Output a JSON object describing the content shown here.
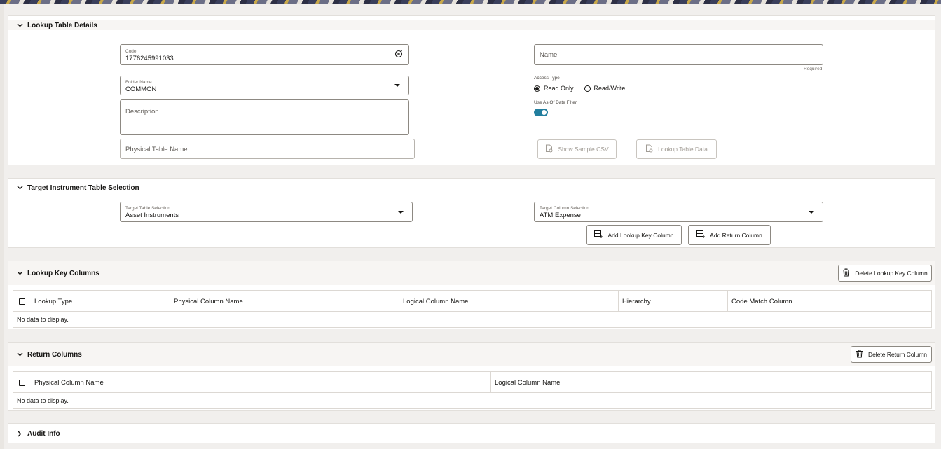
{
  "lookup_table_details": {
    "title": "Lookup Table Details",
    "code": {
      "label": "Code",
      "value": "1776245991033"
    },
    "name": {
      "placeholder": "Name",
      "helper": "Required"
    },
    "folder": {
      "label": "Folder Name",
      "value": "COMMON"
    },
    "access_type": {
      "label": "Access Type",
      "options": [
        {
          "label": "Read Only",
          "selected": true
        },
        {
          "label": "Read/Write",
          "selected": false
        }
      ]
    },
    "as_of_date_filter": {
      "label": "Use As Of Date Filter",
      "enabled": true
    },
    "description": {
      "placeholder": "Description"
    },
    "physical_table_name": {
      "placeholder": "Physical Table Name"
    },
    "show_sample_csv": "Show Sample CSV",
    "lookup_table_data": "Lookup Table Data"
  },
  "target_instrument": {
    "title": "Target Instrument Table Selection",
    "target_table": {
      "label": "Target Table Selection",
      "value": "Asset Instruments"
    },
    "target_column": {
      "label": "Target Column Selection",
      "value": "ATM Expense"
    },
    "add_lookup_key_column": "Add Lookup Key Column",
    "add_return_column": "Add Return Column"
  },
  "lookup_key_columns": {
    "title": "Lookup Key Columns",
    "delete_button": "Delete Lookup Key Column",
    "columns": [
      "Lookup Type",
      "Physical Column Name",
      "Logical Column Name",
      "Hierarchy",
      "Code Match Column"
    ],
    "empty_text": "No data to display."
  },
  "return_columns": {
    "title": "Return Columns",
    "delete_button": "Delete Return Column",
    "columns": [
      "Physical Column Name",
      "Logical Column Name"
    ],
    "empty_text": "No data to display."
  },
  "audit_info": {
    "title": "Audit Info"
  },
  "colors": {
    "accent": "#227e9e",
    "border": "#8d8982",
    "text": "#161513"
  }
}
